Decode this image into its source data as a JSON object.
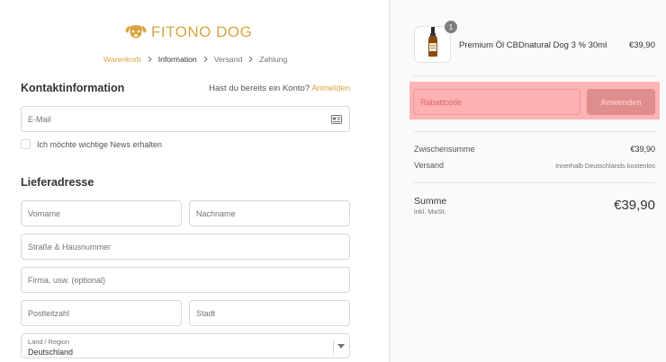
{
  "brand": {
    "name": "FITONO DOG",
    "accent_color": "#d9a441",
    "logo_icon": "dog-face-icon"
  },
  "breadcrumb": {
    "items": [
      "Warenkorb",
      "Information",
      "Versand",
      "Zahlung"
    ],
    "separator_icon": "chevron-right-icon"
  },
  "contact": {
    "title": "Kontaktinformation",
    "account_prompt": "Hast du bereits ein Konto?",
    "login_link": "Anmelden",
    "email_placeholder": "E-Mail",
    "email_icon": "contact-card-icon",
    "newsletter_label": "Ich möchte wichtige News erhalten"
  },
  "shipping": {
    "title": "Lieferadresse",
    "first_name_placeholder": "Vorname",
    "last_name_placeholder": "Nachname",
    "street_placeholder": "Straße & Hausnummer",
    "company_placeholder": "Firma, usw. (optional)",
    "zip_placeholder": "Postleitzahl",
    "city_placeholder": "Stadt",
    "country_label": "Land / Region",
    "country_value": "Deutschland"
  },
  "summary": {
    "product": {
      "quantity": "1",
      "name": "Premium Öl CBDnatural Dog 3 % 30ml",
      "price": "€39,90",
      "thumbnail_icon": "oil-bottle-icon"
    },
    "discount": {
      "placeholder": "Rabattcode",
      "apply_label": "Anwenden",
      "highlight_color": "#ffb3b3"
    },
    "subtotal_label": "Zwischensumme",
    "subtotal_value": "€39,90",
    "shipping_label": "Versand",
    "shipping_value": "Innerhalb Deutschlands kostenlos",
    "total_label": "Summe",
    "total_sub": "inkl. MwSt.",
    "total_value": "€39,90"
  }
}
